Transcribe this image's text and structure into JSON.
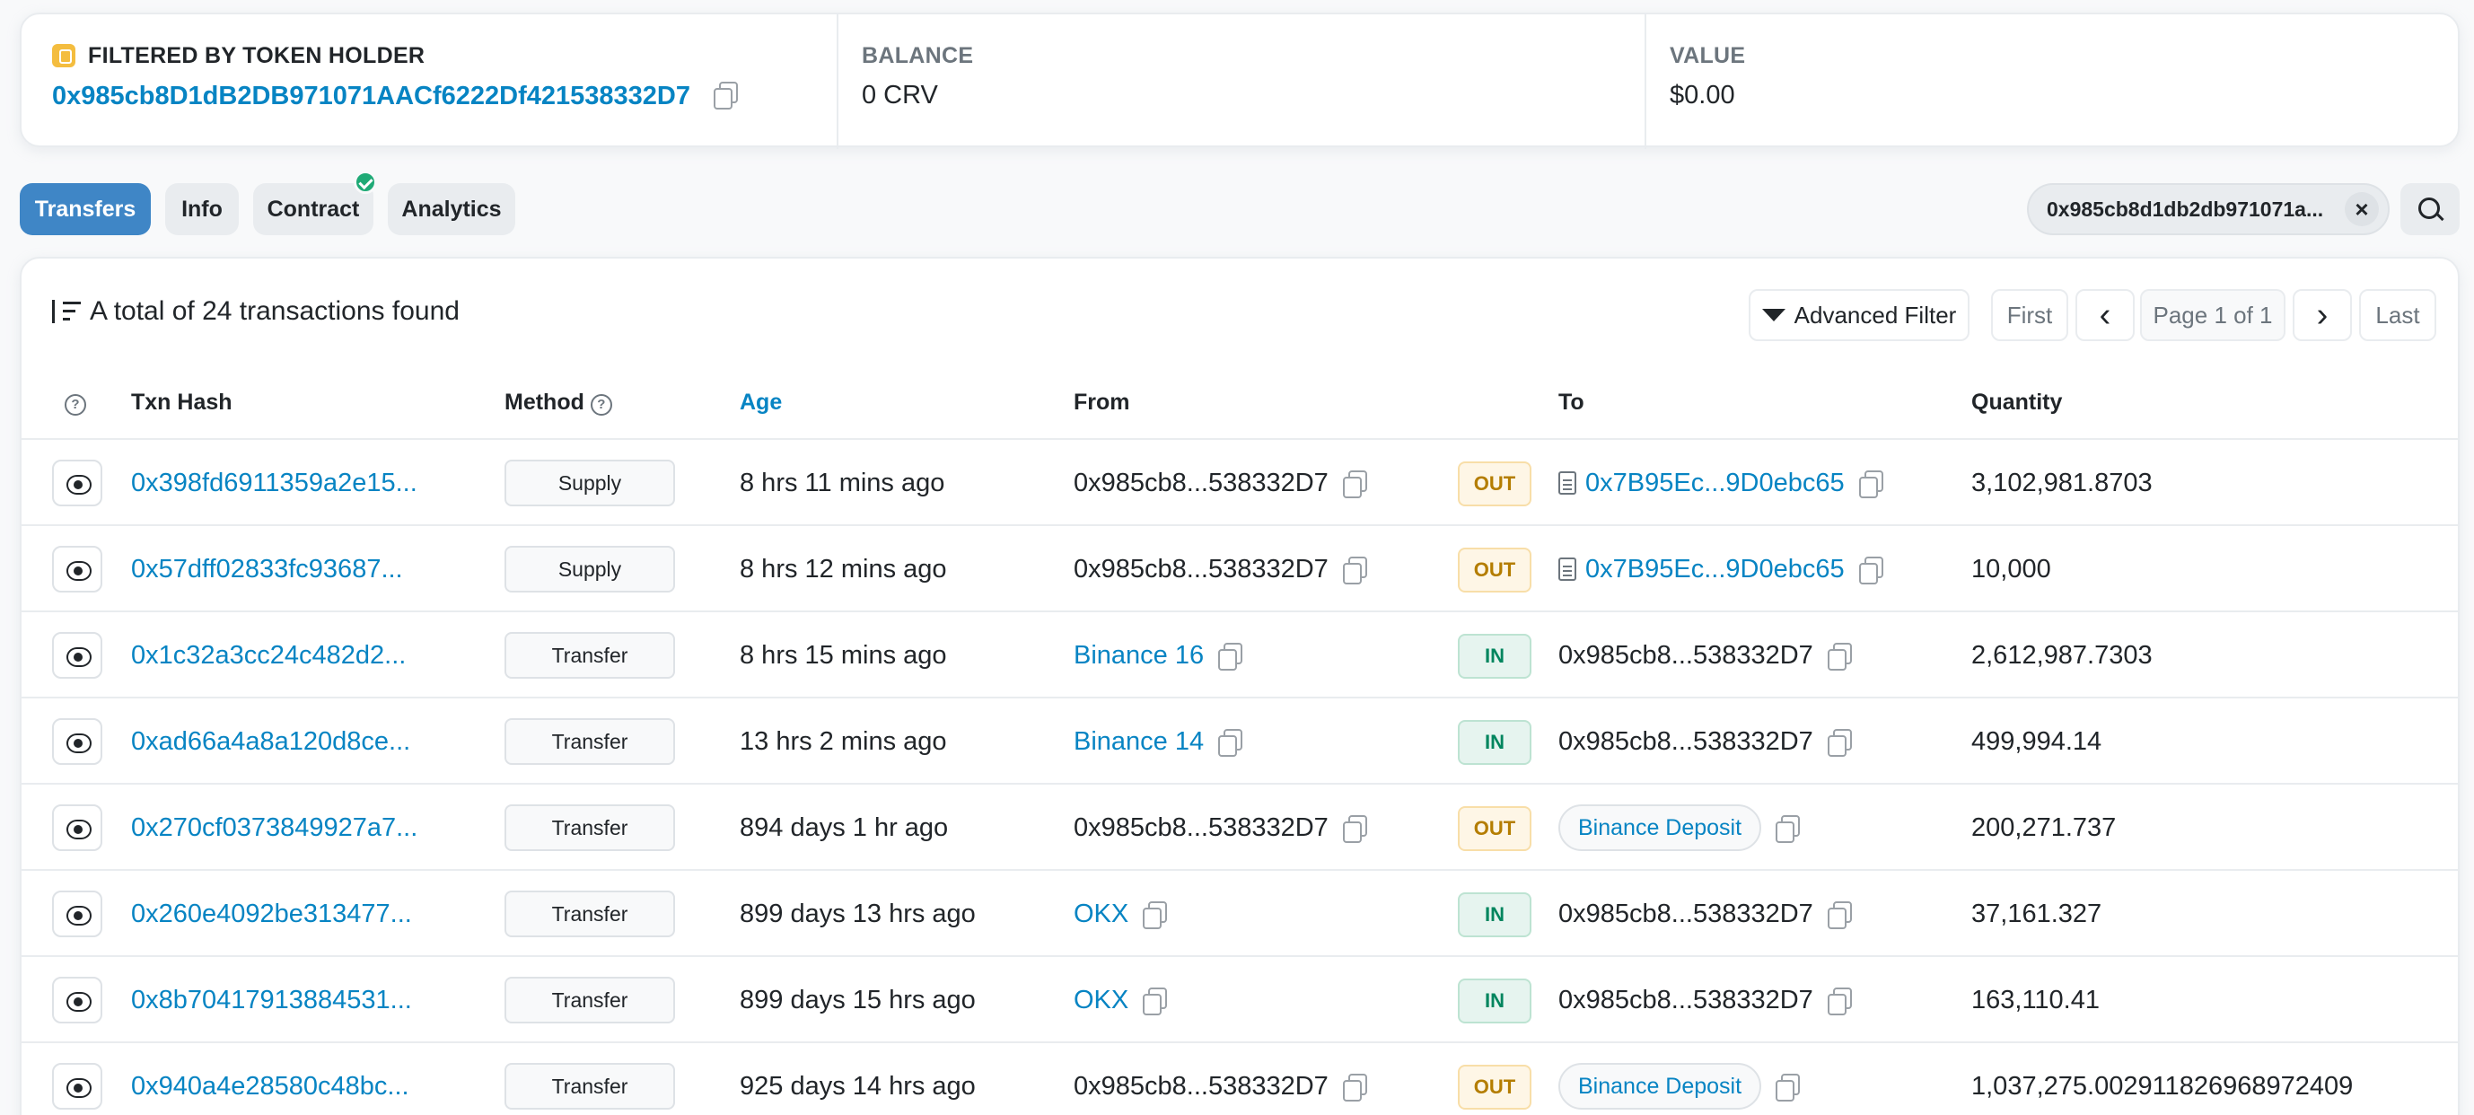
{
  "summary": {
    "filter_label": "FILTERED BY TOKEN HOLDER",
    "holder_address": "0x985cb8D1dB2DB971071AACf6222Df421538332D7",
    "balance_label": "BALANCE",
    "balance_value": "0 CRV",
    "value_label": "VALUE",
    "value_value": "$0.00"
  },
  "tabs": {
    "transfers": "Transfers",
    "info": "Info",
    "contract": "Contract",
    "analytics": "Analytics"
  },
  "filter_pill": {
    "text": "0x985cb8d1db2db971071a...",
    "close": "×"
  },
  "toolbar": {
    "total_text": "A total of 24 transactions found",
    "advanced_filter": "Advanced Filter",
    "first": "First",
    "prev": "‹",
    "page": "Page 1 of 1",
    "next": "›",
    "last": "Last"
  },
  "table": {
    "headers": {
      "hash": "Txn Hash",
      "method": "Method",
      "age": "Age",
      "from": "From",
      "to": "To",
      "quantity": "Quantity"
    },
    "rows": [
      {
        "hash": "0x398fd6911359a2e15...",
        "method": "Supply",
        "age": "8 hrs 11 mins ago",
        "from": "0x985cb8...538332D7",
        "dir": "OUT",
        "to": "0x7B95Ec...9D0ebc65",
        "quantity": "3,102,981.8703"
      },
      {
        "hash": "0x57dff02833fc93687...",
        "method": "Supply",
        "age": "8 hrs 12 mins ago",
        "from": "0x985cb8...538332D7",
        "dir": "OUT",
        "to": "0x7B95Ec...9D0ebc65",
        "quantity": "10,000"
      },
      {
        "hash": "0x1c32a3cc24c482d2...",
        "method": "Transfer",
        "age": "8 hrs 15 mins ago",
        "from": "Binance 16",
        "dir": "IN",
        "to": "0x985cb8...538332D7",
        "quantity": "2,612,987.7303"
      },
      {
        "hash": "0xad66a4a8a120d8ce...",
        "method": "Transfer",
        "age": "13 hrs 2 mins ago",
        "from": "Binance 14",
        "dir": "IN",
        "to": "0x985cb8...538332D7",
        "quantity": "499,994.14"
      },
      {
        "hash": "0x270cf0373849927a7...",
        "method": "Transfer",
        "age": "894 days 1 hr ago",
        "from": "0x985cb8...538332D7",
        "dir": "OUT",
        "to": "Binance Deposit",
        "quantity": "200,271.737"
      },
      {
        "hash": "0x260e4092be313477...",
        "method": "Transfer",
        "age": "899 days 13 hrs ago",
        "from": "OKX",
        "dir": "IN",
        "to": "0x985cb8...538332D7",
        "quantity": "37,161.327"
      },
      {
        "hash": "0x8b70417913884531...",
        "method": "Transfer",
        "age": "899 days 15 hrs ago",
        "from": "OKX",
        "dir": "IN",
        "to": "0x985cb8...538332D7",
        "quantity": "163,110.41"
      },
      {
        "hash": "0x940a4e28580c48bc...",
        "method": "Transfer",
        "age": "925 days 14 hrs ago",
        "from": "0x985cb8...538332D7",
        "dir": "OUT",
        "to": "Binance Deposit",
        "quantity": "1,037,275.002911826968972409"
      }
    ]
  },
  "colors": {
    "accent": "#3f86c6",
    "link": "#0784c3",
    "out_badge": "#b47d00",
    "in_badge": "#00855e"
  }
}
